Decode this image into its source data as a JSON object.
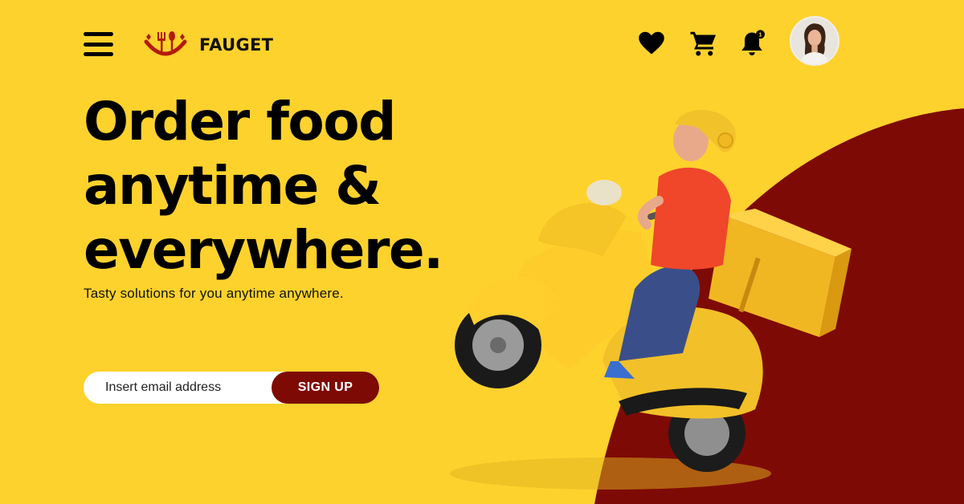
{
  "brand": {
    "name": "FAUGET",
    "logo_icon": "fork-spoon-smile-icon"
  },
  "header": {
    "menu_icon": "hamburger-menu-icon",
    "actions": [
      {
        "name": "favorites",
        "icon": "heart-icon"
      },
      {
        "name": "cart",
        "icon": "shopping-cart-icon"
      },
      {
        "name": "notifications",
        "icon": "bell-icon",
        "badge": "1"
      }
    ],
    "avatar": "user-avatar"
  },
  "hero": {
    "headline_lines": [
      "Order food",
      "anytime &",
      "everywhere."
    ],
    "subtitle": "Tasty solutions for you anytime anywhere.",
    "email_placeholder": "Insert email address",
    "signup_label": "SIGN UP",
    "illustration": "delivery-rider-scooter"
  },
  "colors": {
    "background": "#FED22D",
    "accent": "#7E0A05",
    "text": "#000000"
  }
}
